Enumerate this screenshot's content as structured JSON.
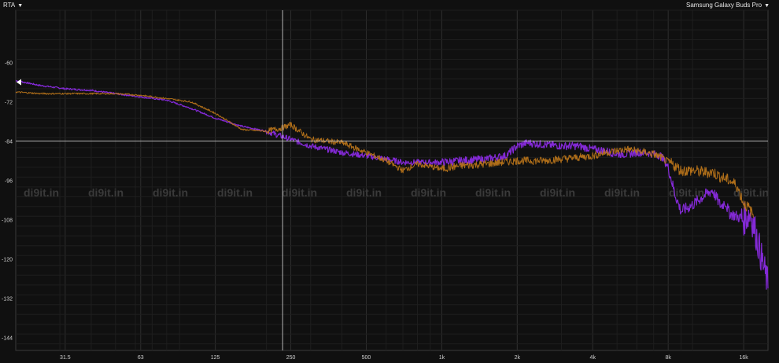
{
  "toolbar": {
    "mode_label": "RTA",
    "source_label": "Samsung Galaxy Buds Pro",
    "caret": "▼"
  },
  "colors": {
    "background": "#101010",
    "grid_major": "#2e2e2e",
    "grid_minor": "#1e1e1e",
    "cursor_line": "#cfcfcf",
    "series_purple": "#8a2be2",
    "series_orange": "#b8741a",
    "watermark": "#3a3a3a",
    "tick_text": "#cfcfcf"
  },
  "watermark": {
    "text": "di9it.in",
    "repeat": 12
  },
  "cursor": {
    "freq": 232,
    "db": -84
  },
  "marker": {
    "db": -66
  },
  "chart_data": {
    "type": "line",
    "title": "",
    "xlabel": "",
    "ylabel": "",
    "xscale": "log",
    "xlim": [
      20,
      20000
    ],
    "ylim": [
      -148,
      -44
    ],
    "x_ticks": [
      {
        "value": 31.5,
        "label": "31.5"
      },
      {
        "value": 63,
        "label": "63"
      },
      {
        "value": 125,
        "label": "125"
      },
      {
        "value": 250,
        "label": "250"
      },
      {
        "value": 500,
        "label": "500"
      },
      {
        "value": 1000,
        "label": "1k"
      },
      {
        "value": 2000,
        "label": "2k"
      },
      {
        "value": 4000,
        "label": "4k"
      },
      {
        "value": 8000,
        "label": "8k"
      },
      {
        "value": 16000,
        "label": "16k"
      }
    ],
    "y_ticks": [
      -60,
      -72,
      -84,
      -96,
      -108,
      -120,
      -132,
      -144
    ],
    "grid": true,
    "series": [
      {
        "color": "#8a2be2",
        "x": [
          20,
          25,
          31.5,
          40,
          50,
          63,
          80,
          100,
          125,
          160,
          200,
          250,
          300,
          400,
          500,
          600,
          700,
          800,
          1000,
          1200,
          1500,
          1800,
          2000,
          2200,
          2500,
          3000,
          3500,
          4000,
          4500,
          5000,
          5500,
          6000,
          6500,
          7000,
          7500,
          8000,
          8500,
          9000,
          10000,
          11000,
          12000,
          13000,
          13500,
          14000,
          15000,
          16000,
          17000,
          18000,
          19000,
          20000
        ],
        "y": [
          -65.5,
          -67,
          -68,
          -68.5,
          -69.5,
          -70.5,
          -71.5,
          -74,
          -77,
          -79.5,
          -81,
          -83.5,
          -85.5,
          -87.5,
          -88.5,
          -89.5,
          -90.5,
          -90.5,
          -90.5,
          -90,
          -89.5,
          -88.5,
          -85.5,
          -84.5,
          -85,
          -85.5,
          -85.5,
          -86.5,
          -87,
          -88,
          -88,
          -87.5,
          -87.5,
          -88,
          -88.5,
          -92,
          -100,
          -105.5,
          -103.5,
          -101,
          -99,
          -104,
          -102.5,
          -106,
          -107,
          -108,
          -106,
          -113,
          -121,
          -128
        ]
      },
      {
        "color": "#b8741a",
        "x": [
          20,
          25,
          31.5,
          40,
          50,
          63,
          80,
          100,
          125,
          160,
          200,
          230,
          250,
          300,
          400,
          500,
          600,
          700,
          800,
          1000,
          1200,
          1500,
          2000,
          2500,
          3000,
          3500,
          4000,
          4500,
          5000,
          5500,
          6000,
          6500,
          7000,
          7500,
          8000,
          8500,
          9000,
          10000,
          11000,
          12000,
          13000,
          14000,
          15000,
          16000,
          17000,
          17500
        ],
        "y": [
          -69,
          -69.5,
          -69.5,
          -69.5,
          -69.5,
          -70,
          -71,
          -72,
          -75.5,
          -80.5,
          -81,
          -80,
          -79,
          -83.5,
          -84.5,
          -87.5,
          -90,
          -93,
          -91,
          -92.5,
          -91.5,
          -91,
          -90,
          -90,
          -89.5,
          -89,
          -88.5,
          -87.5,
          -87,
          -86.5,
          -87,
          -87.5,
          -88,
          -89,
          -90.5,
          -91.5,
          -93,
          -93,
          -93.5,
          -93.5,
          -95,
          -96,
          -97.5,
          -103,
          -105,
          -107
        ]
      }
    ]
  }
}
